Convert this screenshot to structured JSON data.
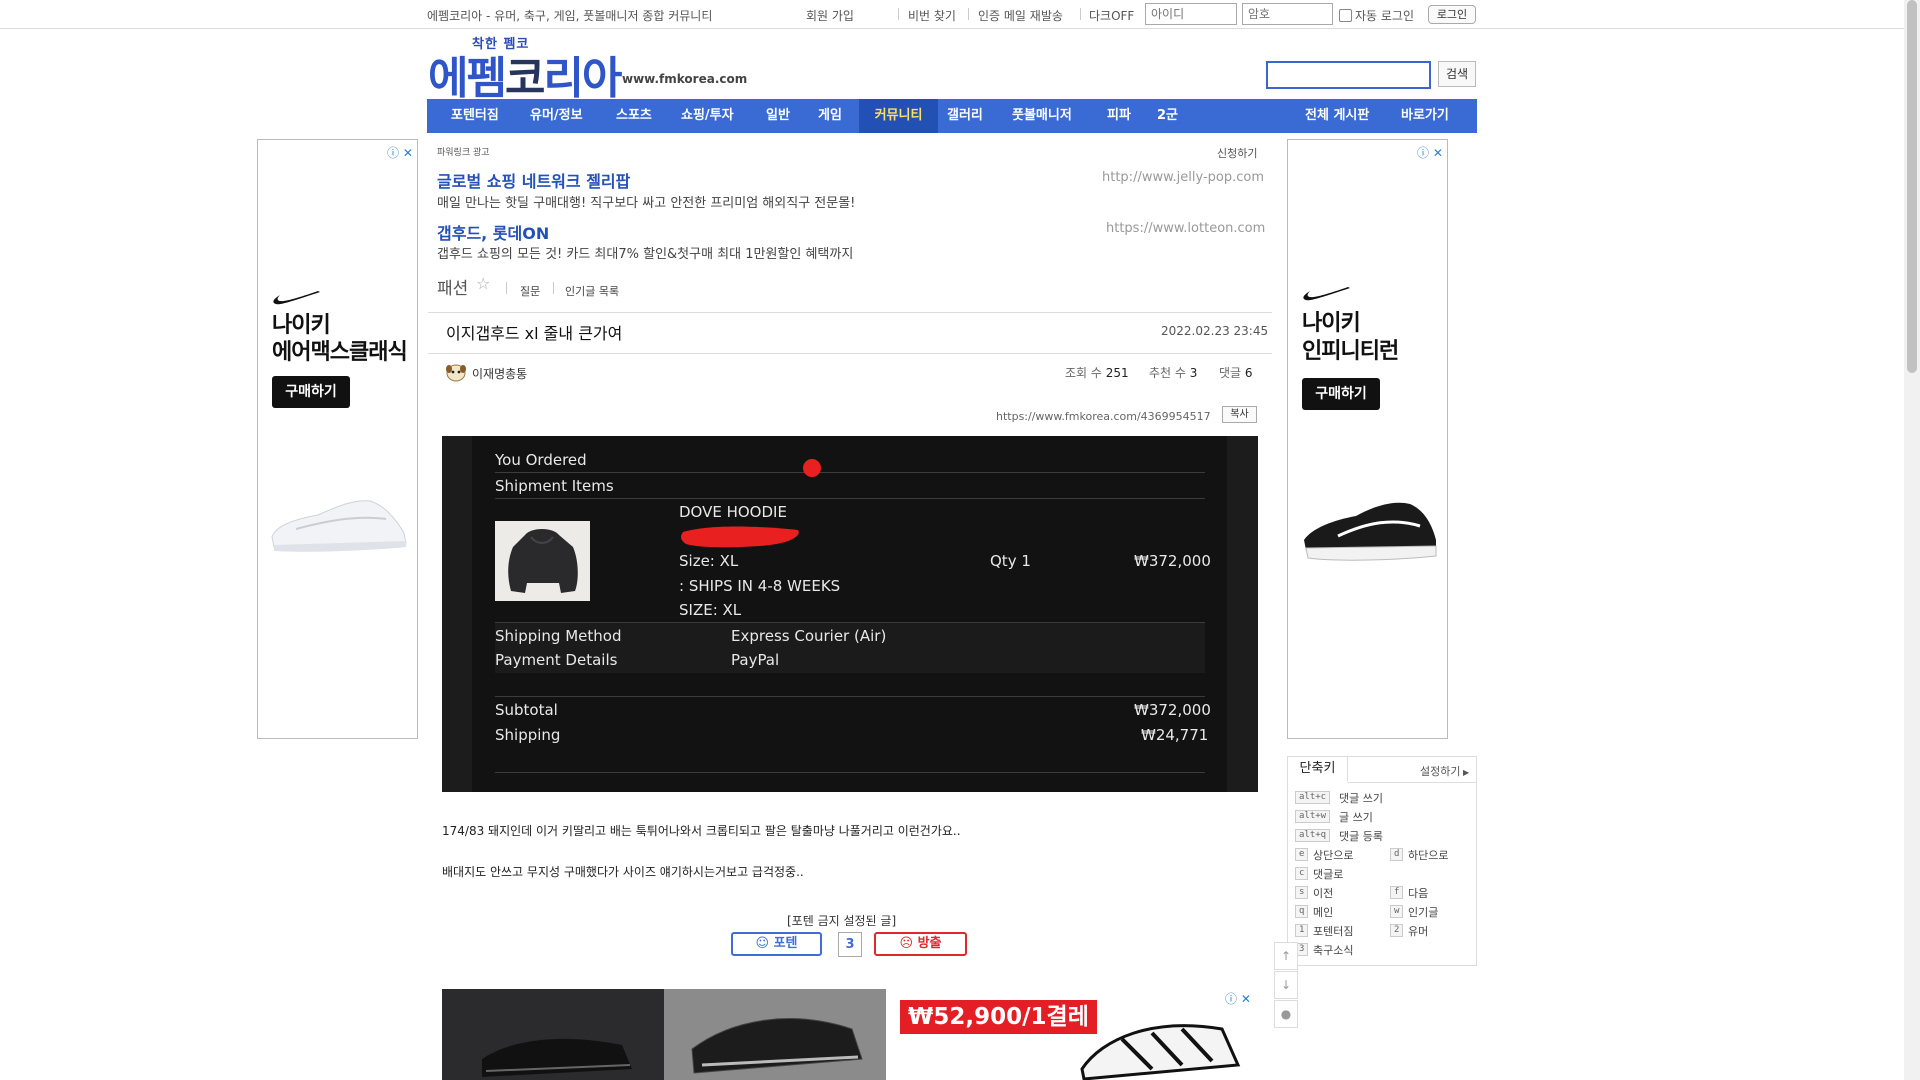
{
  "topbar": {
    "site_desc": "에펨코리아 - 유머, 축구, 게임, 풋볼매니저 종합 커뮤니티",
    "links": [
      "회원 가입",
      "비번 찾기",
      "인증 메일 재발송",
      "다크OFF"
    ],
    "id_placeholder": "아이디",
    "pw_placeholder": "암호",
    "auto_login": "자동 로그인",
    "login_button": "로그인"
  },
  "header": {
    "logo_small": "착한 펨코",
    "logo_main_a": "에펨",
    "logo_main_b": "코",
    "logo_main_c": "리아",
    "logo_url": "www.fmkorea.com",
    "search_button": "검색"
  },
  "nav": {
    "items": [
      "포텐터짐",
      "유머/정보",
      "스포츠",
      "쇼핑/투자",
      "일반",
      "게임",
      "커뮤니티",
      "갤러리",
      "풋볼매니저",
      "피파",
      "2군"
    ],
    "active_index": 6,
    "right_items": [
      "전체 게시판",
      "바로가기"
    ]
  },
  "side_ads": {
    "left": {
      "title_line1": "나이키",
      "title_line2": "에어맥스클래식",
      "button": "구매하기"
    },
    "right": {
      "title_line1": "나이키",
      "title_line2": "인피니티런",
      "button": "구매하기"
    },
    "corner": "ⓘ ✕"
  },
  "powerlink": {
    "label": "파워링크 광고",
    "apply": "신청하기",
    "ads": [
      {
        "title": "글로벌 쇼핑 네트워크 젤리팝",
        "desc": "매일 만나는 핫딜 구매대행! 직구보다 싸고 안전한 프리미엄 해외직구 전문몰!",
        "url": "http://www.jelly-pop.com"
      },
      {
        "title": "갭후드, 롯데ON",
        "desc": "갭후드 쇼핑의 모든 것! 카드 최대7% 할인&첫구매 최대 1만원할인 혜택까지",
        "url": "https://www.lotteon.com"
      }
    ]
  },
  "board": {
    "name": "패션",
    "links": [
      "질문",
      "인기글 목록"
    ]
  },
  "post": {
    "title": "이지갭후드 xl 줄내 큰가여",
    "date": "2022.02.23 23:45",
    "author": "이재명총통",
    "views_label": "조회 수",
    "views": "251",
    "recommend_label": "추천 수",
    "recommend": "3",
    "comments_label": "댓글",
    "comments": "6",
    "url": "https://www.fmkorea.com/4369954517",
    "copy": "복사",
    "body_line1": "174/83 돼지인데 이거 키딸리고 배는 툭튀어나와서 크롭티되고 팔은 탈출마냥 나풀거리고 이런건가요..",
    "body_line2": "배대지도 안쓰고 무지성 구매했다가 사이즈 얘기하시는거보고 급걱정중.."
  },
  "receipt": {
    "you_ordered": "You Ordered",
    "shipment_items": "Shipment Items",
    "item_name": "DOVE HOODIE",
    "item_size": "Size: XL",
    "item_ships": ": SHIPS IN 4-8 WEEKS",
    "item_size2": "SIZE: XL",
    "qty": "Qty 1",
    "price": "₩372,000",
    "shipping_method_label": "Shipping Method",
    "shipping_method": "Express Courier (Air)",
    "payment_label": "Payment Details",
    "payment": "PayPal",
    "subtotal_label": "Subtotal",
    "subtotal": "₩372,000",
    "shipping_label": "Shipping",
    "shipping": "₩24,771"
  },
  "vote": {
    "caption": "[포텐 금지 설정된 글]",
    "up": "포텐",
    "count": "3",
    "down": "방출"
  },
  "shortcuts": {
    "tab": "단축키",
    "settings": "설정하기",
    "wide": [
      {
        "key": "alt+c",
        "label": "댓글 쓰기"
      },
      {
        "key": "alt+w",
        "label": "글 쓰기"
      },
      {
        "key": "alt+q",
        "label": "댓글 등록"
      }
    ],
    "left": [
      {
        "key": "e",
        "label": "상단으로"
      },
      {
        "key": "c",
        "label": "댓글로"
      },
      {
        "key": "s",
        "label": "이전"
      },
      {
        "key": "q",
        "label": "메인"
      },
      {
        "key": "1",
        "label": "포텐터짐"
      },
      {
        "key": "3",
        "label": "축구소식"
      }
    ],
    "right": [
      {
        "key": "d",
        "label": "하단으로"
      },
      {
        "key": "f",
        "label": "다음"
      },
      {
        "key": "w",
        "label": "인기글"
      },
      {
        "key": "2",
        "label": "유머"
      }
    ]
  },
  "bottom_ad": {
    "price": "₩52,900/1결레"
  }
}
